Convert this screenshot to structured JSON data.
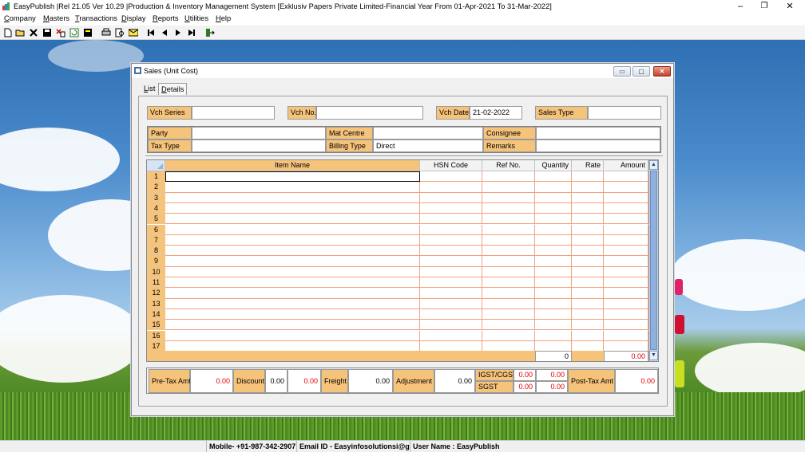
{
  "app": {
    "title": "EasyPublish |Rel 21.05 Ver 10.29 |Production & Inventory Management System [Exklusiv Papers Private Limited-Financial Year From 01-Apr-2021 To 31-Mar-2022]",
    "minimize_glyph": "–",
    "restore_glyph": "❐",
    "close_glyph": "✕"
  },
  "menu": {
    "items": [
      {
        "u": "C",
        "rest": "ompany"
      },
      {
        "u": "M",
        "rest": "asters"
      },
      {
        "u": "T",
        "rest": "ransactions"
      },
      {
        "u": "D",
        "rest": "isplay"
      },
      {
        "u": "R",
        "rest": "eports"
      },
      {
        "u": "U",
        "rest": "tilities"
      },
      {
        "u": "H",
        "rest": "elp"
      }
    ]
  },
  "toolbar": {
    "icons": [
      "new-icon",
      "open-folder-icon",
      "delete-icon",
      "save-icon",
      "delete-record-icon",
      "refresh-icon",
      "calculator-icon",
      "print-icon",
      "print-preview-icon",
      "email-icon",
      "first-record-icon",
      "previous-record-icon",
      "next-record-icon",
      "last-record-icon",
      "exit-icon"
    ]
  },
  "window": {
    "title": "Sales (Unit Cost)",
    "min_glyph": "▭",
    "max_glyph": "▢",
    "close_glyph": "✕"
  },
  "tabs": {
    "list": {
      "u": "L",
      "rest": "ist"
    },
    "details": {
      "u": "D",
      "rest": "etails"
    }
  },
  "header": {
    "vch_series_label": "Vch Series",
    "vch_series_value": "",
    "vch_no_label": "Vch No.",
    "vch_no_value": "",
    "vch_date_label": "Vch Date",
    "vch_date_value": "21-02-2022",
    "sales_type_label": "Sales Type",
    "sales_type_value": ""
  },
  "party": {
    "party_label": "Party",
    "party_value": "",
    "mat_centre_label": "Mat Centre",
    "mat_centre_value": "",
    "consignee_label": "Consignee",
    "consignee_value": "",
    "tax_type_label": "Tax Type",
    "tax_type_value": "",
    "billing_type_label": "Billing Type",
    "billing_type_value": "Direct",
    "remarks_label": "Remarks",
    "remarks_value": ""
  },
  "grid": {
    "columns": [
      "Item Name",
      "HSN Code",
      "Ref No.",
      "Quantity",
      "Rate",
      "Amount"
    ],
    "rows": [
      "1",
      "2",
      "3",
      "4",
      "5",
      "6",
      "7",
      "8",
      "9",
      "10",
      "11",
      "12",
      "13",
      "14",
      "15",
      "16",
      "17"
    ],
    "total_quantity": "0",
    "total_amount": "0.00",
    "scroll_up": "▲",
    "scroll_down": "▼"
  },
  "summary": {
    "pretax_label": "Pre-Tax Amt",
    "pretax_value": "0.00",
    "discount_label": "Discount",
    "discount_pct": "0.00",
    "discount_value": "0.00",
    "freight_label": "Freight",
    "freight_value": "0.00",
    "adjustment_label": "Adjustment",
    "adjustment_value": "0.00",
    "igst_label": "IGST/CGST",
    "igst_rate": "0.00",
    "igst_value": "0.00",
    "sgst_label": "SGST",
    "sgst_rate": "0.00",
    "sgst_value": "0.00",
    "posttax_label": "Post-Tax Amt",
    "posttax_value": "0.00"
  },
  "status": {
    "mobile": "Mobile- +91-987-342-2907",
    "email": "Email ID - Easyinfosolutionsi@gma",
    "user": "User Name : EasyPublish"
  },
  "colors": {
    "label_bg": "#f6c37b",
    "grid_line": "#f0a27e",
    "value_red": "#e00000"
  }
}
